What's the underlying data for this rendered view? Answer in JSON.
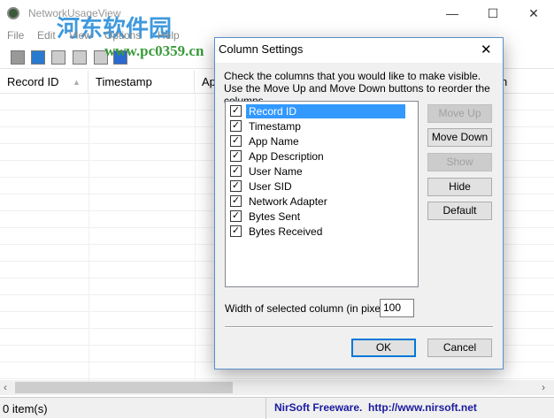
{
  "window": {
    "title": "NetworkUsageView",
    "minimize": "—",
    "maximize": "☐",
    "close": "✕"
  },
  "menu": [
    "File",
    "Edit",
    "View",
    "Options",
    "Help"
  ],
  "watermark": {
    "text": "河东软件园",
    "url": "www.pc0359.cn"
  },
  "columns": [
    "Record ID",
    "Timestamp",
    "Ap",
    "n"
  ],
  "status": {
    "items": "0 item(s)",
    "credit": "NirSoft Freeware.  http://www.nirsoft.net"
  },
  "dialog": {
    "title": "Column Settings",
    "close": "✕",
    "instructions": "Check the columns that you would like to make visible. Use the Move Up and Move Down buttons to reorder the columns",
    "items": [
      {
        "label": "Record ID",
        "checked": true,
        "selected": true
      },
      {
        "label": "Timestamp",
        "checked": true
      },
      {
        "label": "App Name",
        "checked": true
      },
      {
        "label": "App Description",
        "checked": true
      },
      {
        "label": "User Name",
        "checked": true
      },
      {
        "label": "User SID",
        "checked": true
      },
      {
        "label": "Network Adapter",
        "checked": true
      },
      {
        "label": "Bytes Sent",
        "checked": true
      },
      {
        "label": "Bytes Received",
        "checked": true
      }
    ],
    "buttons": {
      "move_up": "Move Up",
      "move_down": "Move Down",
      "show": "Show",
      "hide": "Hide",
      "default": "Default",
      "ok": "OK",
      "cancel": "Cancel"
    },
    "width_label": "Width of selected column (in pixels):",
    "width_value": "100",
    "check_mark": "✓"
  }
}
